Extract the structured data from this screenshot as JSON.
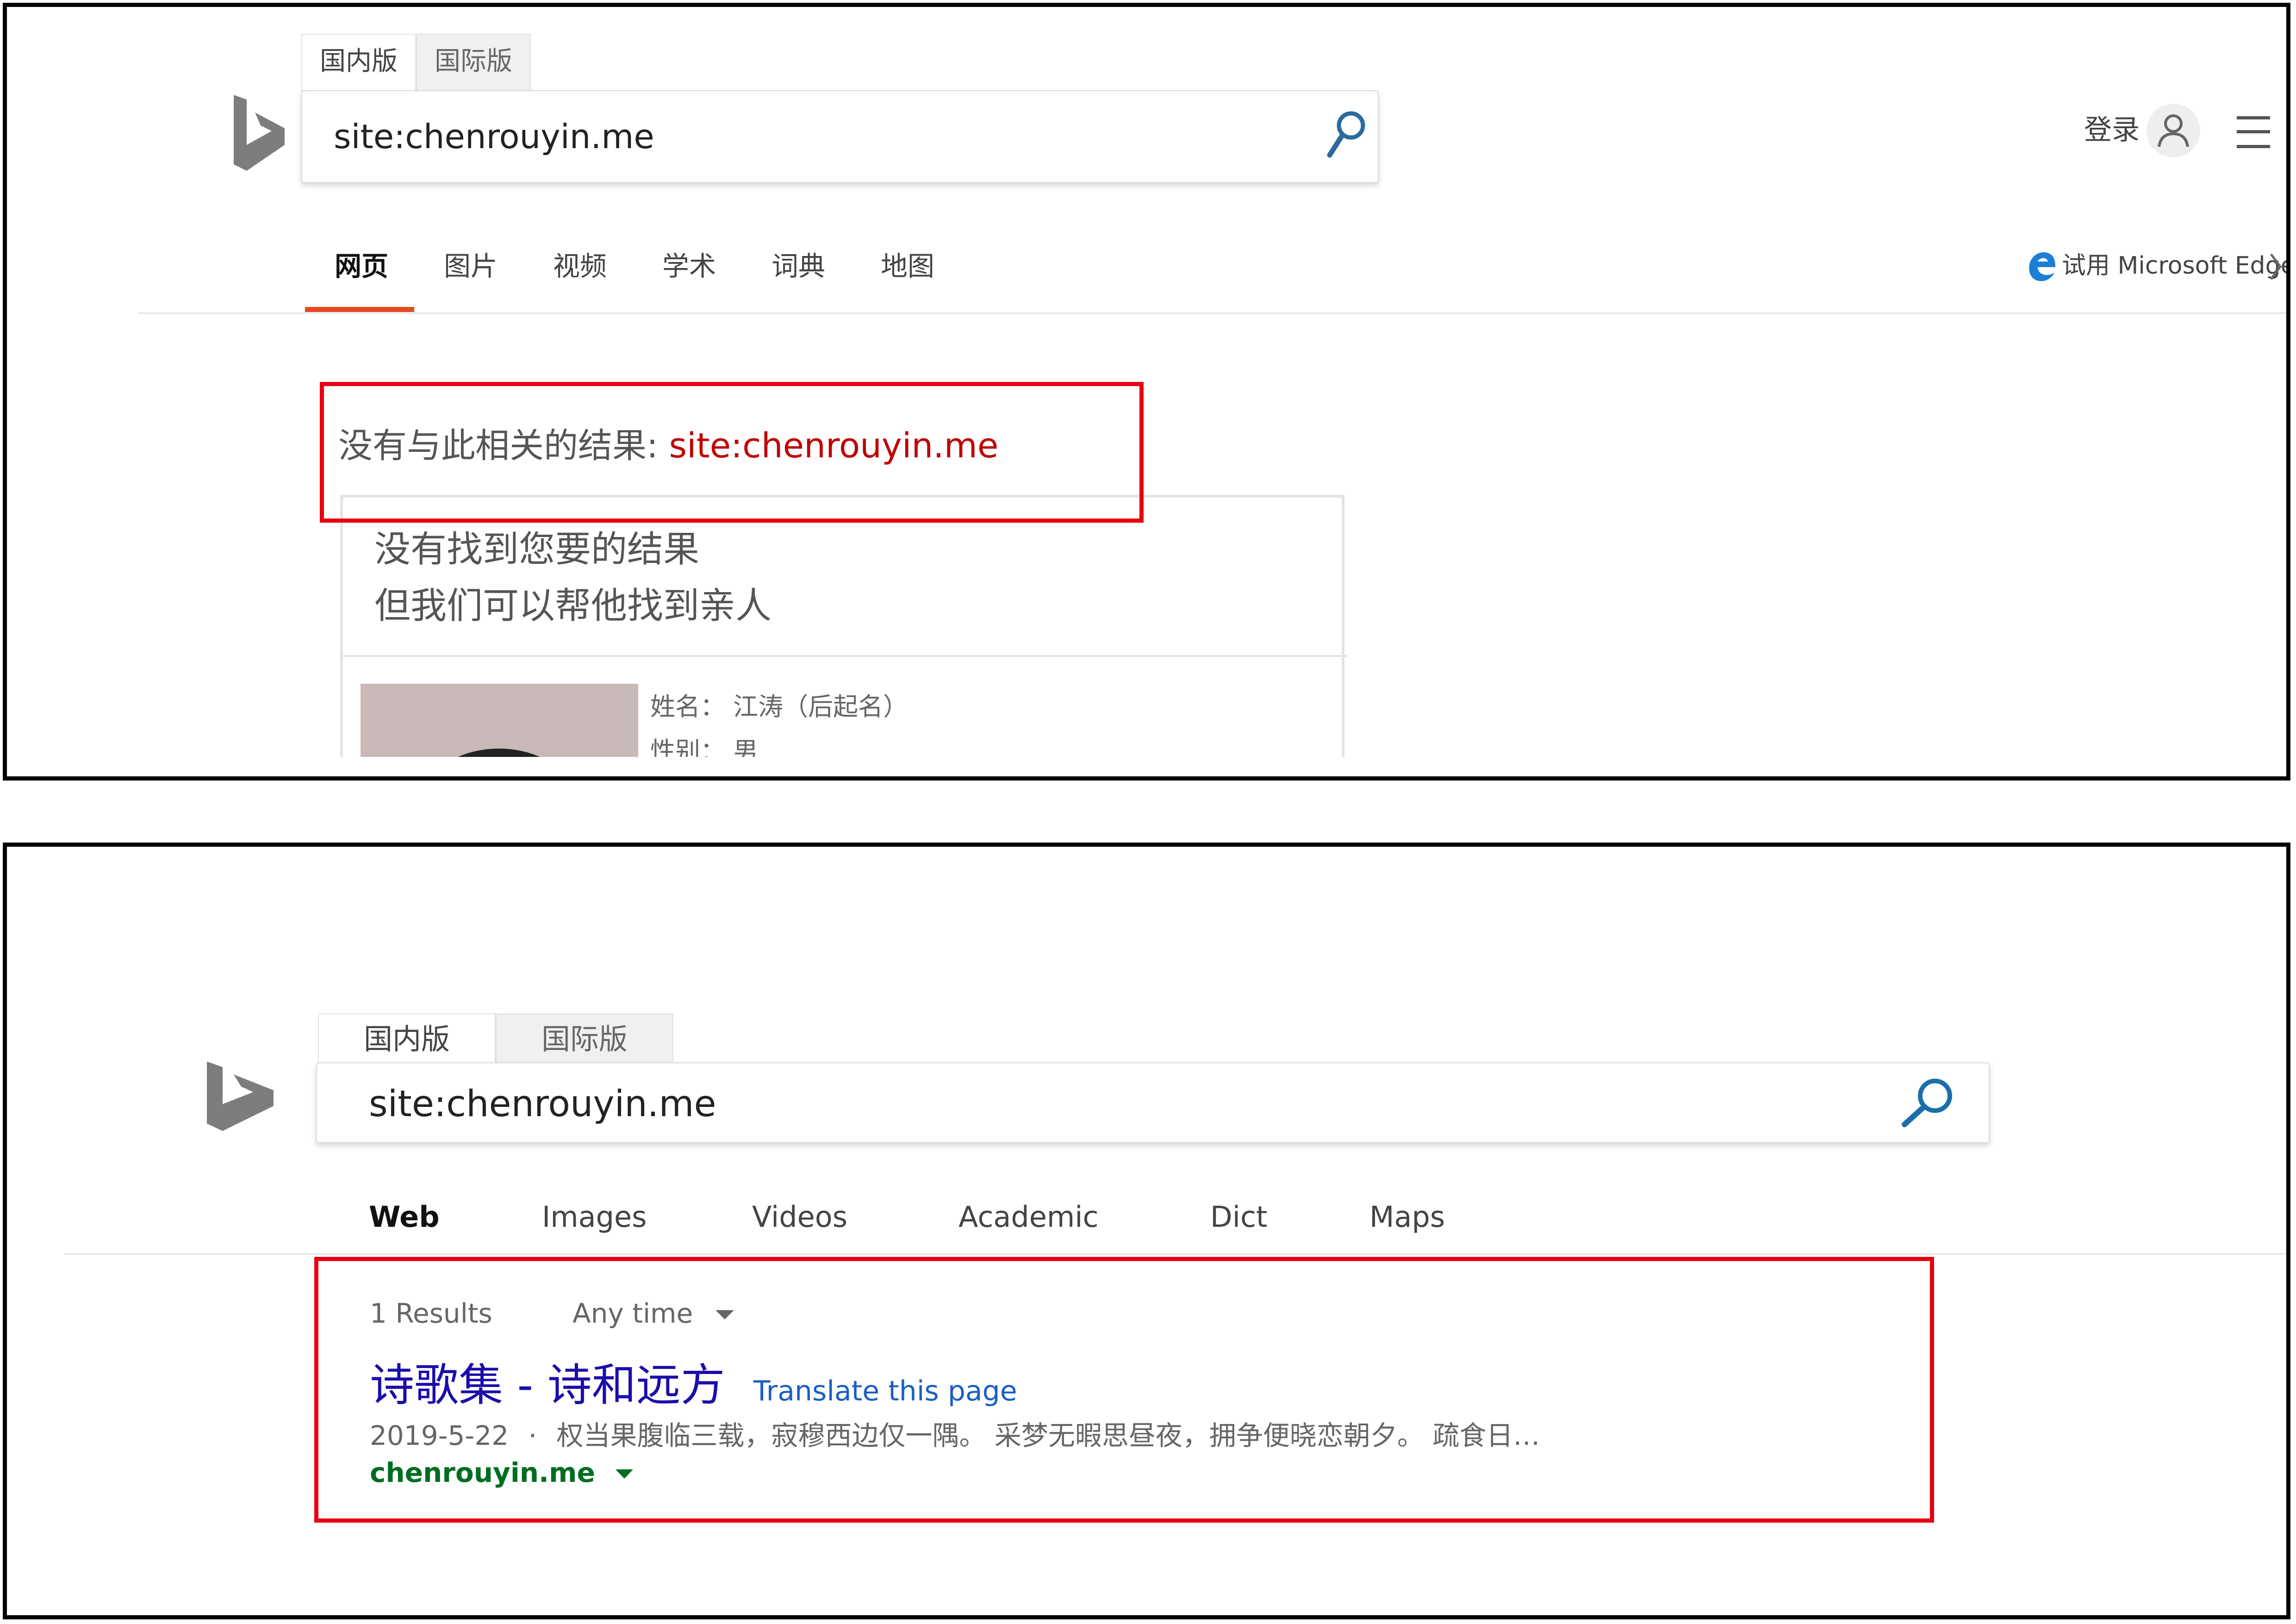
{
  "top": {
    "scope_tabs": [
      "国内版",
      "国际版"
    ],
    "search": {
      "query": "site:chenrouyin.me"
    },
    "header": {
      "login": "登录"
    },
    "nav": [
      "网页",
      "图片",
      "视频",
      "学术",
      "词典",
      "地图"
    ],
    "edge_promo": "试用 Microsoft Edge",
    "no_result": {
      "prefix": "没有与此相关的结果: ",
      "query": "site:chenrouyin.me"
    },
    "missing_card": {
      "line1": "没有找到您要的结果",
      "line2": "但我们可以帮他找到亲人",
      "name_line": "姓名： 江涛（后起名）",
      "gender_line": "性别： 男"
    }
  },
  "bottom": {
    "scope_tabs": [
      "国内版",
      "国际版"
    ],
    "search": {
      "query": "site:chenrouyin.me"
    },
    "nav": [
      "Web",
      "Images",
      "Videos",
      "Academic",
      "Dict",
      "Maps"
    ],
    "results_count": "1 Results",
    "time_filter": "Any time",
    "result": {
      "title": "诗歌集 - 诗和远方",
      "translate": "Translate this page",
      "date": "2019-5-22",
      "snippet": "权当果腹临三载，寂穆西边仅一隅。 采梦无暇思昼夜，拥争便晓恋朝夕。 疏食日…",
      "url": "chenrouyin.me"
    }
  },
  "colors": {
    "highlight_box": "#e60012",
    "nav_active_underline": "#e34a1f",
    "link_blue": "#1a0dab",
    "url_green": "#006d21",
    "bing_gray": "#7d7d7d",
    "query_red": "#c00000"
  },
  "icons": [
    "bing-logo-icon",
    "search-icon",
    "user-avatar-icon",
    "hamburger-menu-icon",
    "edge-browser-icon",
    "chevron-right-icon",
    "dropdown-arrow-icon"
  ]
}
